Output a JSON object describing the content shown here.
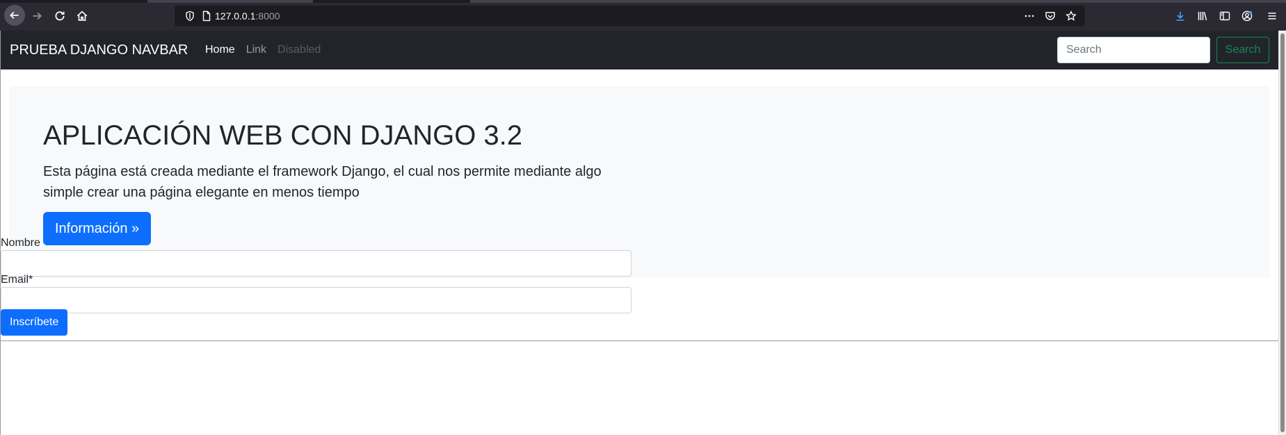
{
  "browser": {
    "url_host": "127.0.0.1",
    "url_port": ":8000",
    "icons": [
      "back-icon",
      "forward-icon",
      "reload-icon",
      "home-icon",
      "shield-icon",
      "page-icon",
      "more-icon",
      "pocket-icon",
      "bookmark-star-icon",
      "download-icon",
      "library-icon",
      "sidebar-icon",
      "account-icon",
      "menu-icon"
    ]
  },
  "navbar": {
    "brand": "PRUEBA DJANGO NAVBAR",
    "links": [
      {
        "label": "Home",
        "state": "active"
      },
      {
        "label": "Link",
        "state": "normal"
      },
      {
        "label": "Disabled",
        "state": "disabled"
      }
    ],
    "search_placeholder": "Search",
    "search_button": "Search"
  },
  "jumbotron": {
    "title": "APLICACIÓN WEB CON DJANGO 3.2",
    "text": "Esta página está creada mediante el framework Django, el cual nos permite mediante algo simple crear una página elegante en menos tiempo",
    "button": "Información »"
  },
  "form": {
    "name_label": "Nombre",
    "name_value": "",
    "email_label": "Email*",
    "email_value": "",
    "submit": "Inscríbete"
  },
  "colors": {
    "navbar_bg": "#212529",
    "primary": "#0d6efd",
    "success": "#198754",
    "jumbotron_bg": "#f8f9fa"
  }
}
